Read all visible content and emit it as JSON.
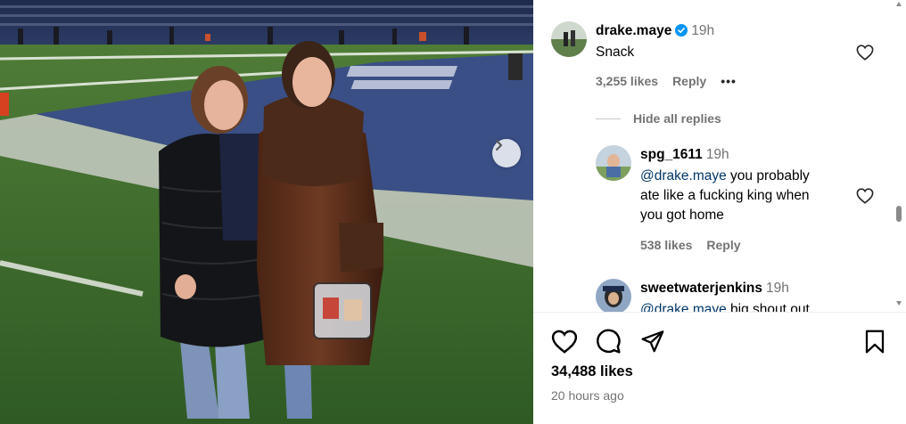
{
  "post": {
    "image_alt": "Two women in winter coats standing on a football field",
    "likes": "34,488 likes",
    "time_ago": "20 hours ago"
  },
  "main_comment": {
    "username": "drake.maye",
    "verified": true,
    "time": "19h",
    "text": "Snack",
    "likes": "3,255 likes",
    "reply_label": "Reply",
    "more_label": "•••",
    "hide_replies_label": "Hide all replies"
  },
  "replies": [
    {
      "username": "spg_1611",
      "time": "19h",
      "mention": "@drake.maye",
      "text_lines": [
        " you probably",
        "ate like a fucking king when",
        "you got home"
      ],
      "likes": "538 likes",
      "reply_label": "Reply"
    },
    {
      "username": "sweetwaterjenkins",
      "time": "19h",
      "mention": "@drake.maye",
      "text": " big shout out"
    }
  ],
  "icons": {
    "like": "heart-icon",
    "comment": "comment-icon",
    "share": "share-icon",
    "save": "bookmark-icon",
    "next": "chevron-right-icon"
  },
  "colors": {
    "mention": "#00376b",
    "verified": "#0095f6",
    "muted": "#737373"
  }
}
